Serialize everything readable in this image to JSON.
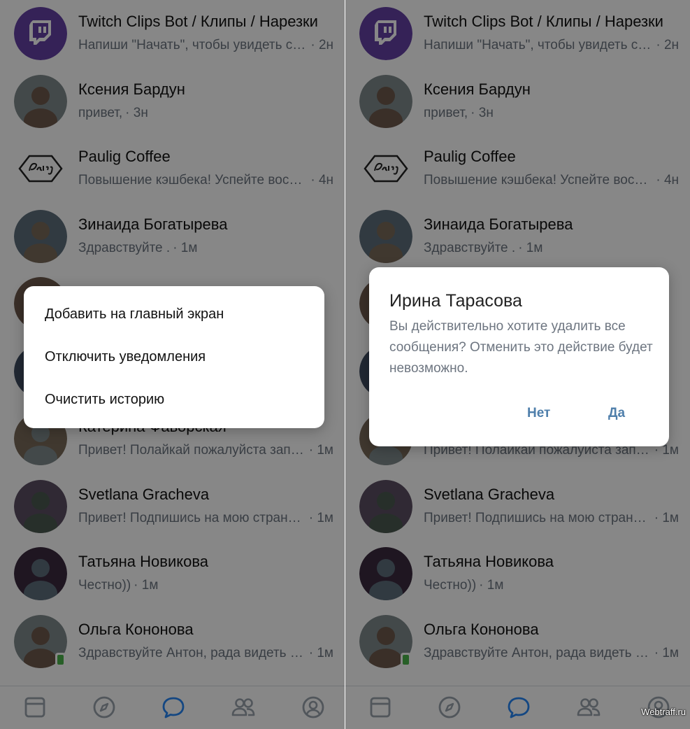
{
  "chats": [
    {
      "name": "Twitch Clips Bot / Клипы / Нарезки",
      "preview": "Напиши \"Начать\", чтобы увидеть сайт с клипами",
      "time": "2н",
      "avatar": "twitch-logo"
    },
    {
      "name": "Ксения Бардун",
      "preview": "привет,",
      "time": "3н",
      "avatar": "photo"
    },
    {
      "name": "Paulig Coffee",
      "preview": "Повышение кэшбека! Успейте воспользоваться",
      "time": "4н",
      "avatar": "paulig-logo"
    },
    {
      "name": "Зинаида Богатырева",
      "preview": "Здравствуйте .",
      "time": "1м",
      "avatar": "photo"
    },
    {
      "name": "",
      "preview": "",
      "time": "",
      "avatar": "photo"
    },
    {
      "name": "",
      "preview": "",
      "time": "",
      "avatar": "photo"
    },
    {
      "name": "Катерина Фаворская",
      "preview": "Привет! Полайкай пожалуйста запись",
      "time": "1м",
      "avatar": "photo"
    },
    {
      "name": "Svetlana Gracheva",
      "preview": "Привет! Подпишись на мою страницу",
      "time": "1м",
      "avatar": "photo"
    },
    {
      "name": "Татьяна Новикова",
      "preview": "Честно))",
      "time": "1м",
      "avatar": "photo"
    },
    {
      "name": "Ольга Кононова",
      "preview": "Здравствуйте Антон, рада видеть вас",
      "time": "1м",
      "avatar": "photo",
      "online_mobile": true
    }
  ],
  "tabs": [
    {
      "name": "tab-feed",
      "icon": "feed-icon"
    },
    {
      "name": "tab-discover",
      "icon": "compass-icon"
    },
    {
      "name": "tab-messages",
      "icon": "chat-bubble-icon",
      "active": true
    },
    {
      "name": "tab-friends",
      "icon": "friends-icon"
    },
    {
      "name": "tab-profile",
      "icon": "profile-icon"
    }
  ],
  "context_menu": {
    "items": [
      "Добавить на главный экран",
      "Отключить уведомления",
      "Очистить историю"
    ]
  },
  "dialog": {
    "title": "Ирина Тарасова",
    "text": "Вы действительно хотите удалить все сообщения? Отменить это действие будет невозможно.",
    "no_label": "Нет",
    "yes_label": "Да"
  },
  "colors": {
    "accent": "#2787f5",
    "dialog_button": "#4f7fab",
    "twitch": "#6441a5",
    "overlay": "rgba(0,0,0,0.47)"
  },
  "watermark": "Webtraff.ru"
}
